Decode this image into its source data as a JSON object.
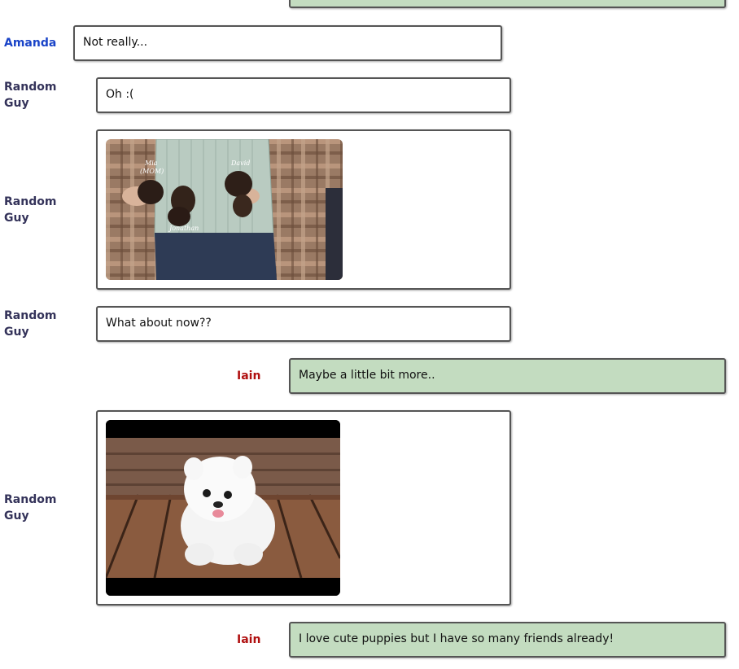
{
  "messages": [
    {
      "sender": "",
      "kind": "text",
      "text": ""
    },
    {
      "sender": "Amanda",
      "kind": "text",
      "text": "Not really..."
    },
    {
      "sender": "Random Guy",
      "kind": "text",
      "text": "Oh :("
    },
    {
      "sender": "Random Guy",
      "kind": "image",
      "image": "family-with-chihuahua-puppies",
      "captions": [
        "Mia",
        "(MOM)",
        "David",
        "Jonathan"
      ]
    },
    {
      "sender": "Random Guy",
      "kind": "text",
      "text": "What about now??"
    },
    {
      "sender": "Iain",
      "kind": "text",
      "text": "Maybe a little bit more.."
    },
    {
      "sender": "Random Guy",
      "kind": "image",
      "image": "white-pomeranian-puppy",
      "captions": []
    },
    {
      "sender": "Iain",
      "kind": "text",
      "text": "I love cute puppies but I have so many friends already!"
    }
  ],
  "colors": {
    "amanda": "#1a44c8",
    "random_guy": "#34335a",
    "iain": "#b01010",
    "own_bubble": "#c3dcc0",
    "other_bubble": "#ffffff"
  }
}
